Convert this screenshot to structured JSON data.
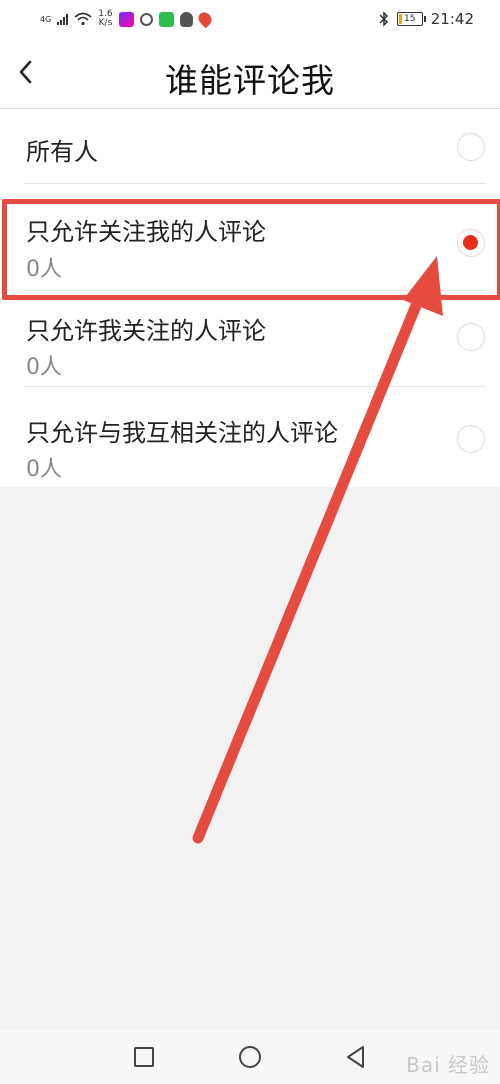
{
  "status_bar": {
    "network": "4G",
    "speed_value": "1.6",
    "speed_unit": "K/s",
    "time": "21:42",
    "battery": "15"
  },
  "header": {
    "title": "谁能评论我",
    "back_icon": "chevron-left-icon"
  },
  "options": [
    {
      "label": "所有人",
      "count": "",
      "selected": false
    },
    {
      "label": "只允许关注我的人评论",
      "count": "0人",
      "selected": true
    },
    {
      "label": "只允许我关注的人评论",
      "count": "0人",
      "selected": false
    },
    {
      "label": "只允许与我互相关注的人评论",
      "count": "0人",
      "selected": false
    }
  ],
  "nav_bar": {
    "icons": [
      "recent-apps-icon",
      "home-icon",
      "back-triangle-icon"
    ]
  },
  "watermark": "Bai 经验",
  "colors": {
    "accent": "#e92d1c",
    "annotation": "#e54b3e"
  }
}
